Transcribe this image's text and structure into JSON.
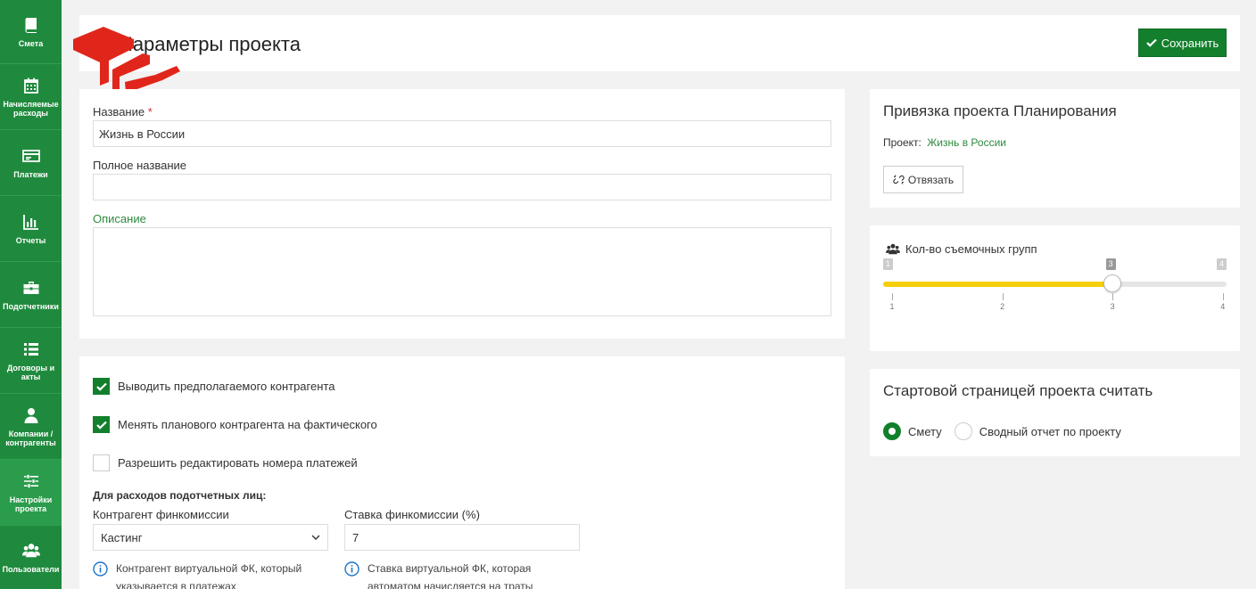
{
  "sidebar": {
    "items": [
      {
        "label": "Смета",
        "icon": "book-icon"
      },
      {
        "label": "Начисляемые расходы",
        "icon": "calendar-icon"
      },
      {
        "label": "Платежи",
        "icon": "card-icon"
      },
      {
        "label": "Отчеты",
        "icon": "bar-chart-icon"
      },
      {
        "label": "Подотчетники",
        "icon": "briefcase-icon"
      },
      {
        "label": "Договоры и акты",
        "icon": "list-icon"
      },
      {
        "label": "Компании / контрагенты",
        "icon": "user-icon"
      },
      {
        "label": "Настройки проекта",
        "icon": "sliders-icon"
      },
      {
        "label": "Пользователи",
        "icon": "users-icon"
      }
    ],
    "active_index": 7
  },
  "header": {
    "title": "Параметры проекта",
    "save_label": "Сохранить"
  },
  "form": {
    "name_label": "Название",
    "name_required_mark": "*",
    "name_value": "Жизнь в России",
    "full_name_label": "Полное название",
    "full_name_value": "",
    "description_label": "Описание",
    "description_value": ""
  },
  "options": {
    "checks": [
      {
        "label": "Выводить предполагаемого контрагента",
        "checked": true
      },
      {
        "label": "Менять планового контрагента на фактического",
        "checked": true
      },
      {
        "label": "Разрешить редактировать номера платежей",
        "checked": false
      }
    ],
    "accountable_title": "Для расходов подотчетных лиц:",
    "counterparty_label": "Контрагент финкомиссии",
    "counterparty_value": "Кастинг",
    "rate_label": "Ставка финкомиссии (%)",
    "rate_value": "7",
    "counterparty_info": "Контрагент виртуальной ФК, который указывается в платежах",
    "rate_info": "Ставка виртуальной ФК, которая автоматом начисляется на траты"
  },
  "binding": {
    "title": "Привязка проекта Планирования",
    "project_label": "Проект:",
    "project_name": "Жизнь в России",
    "unlink_label": "Отвязать"
  },
  "crews": {
    "title": "Кол-во съемочных групп",
    "min": 1,
    "max": 4,
    "value": 3,
    "min_label": "1",
    "max_label": "4",
    "value_label": "3",
    "ticks": [
      "1",
      "2",
      "3",
      "4"
    ],
    "fill_color": "#f5cf0a"
  },
  "start_page": {
    "title": "Стартовой страницей проекта считать",
    "options": [
      {
        "label": "Смету",
        "checked": true
      },
      {
        "label": "Сводный отчет по проекту",
        "checked": false
      }
    ]
  },
  "colors": {
    "sidebar": "#1f8a3d",
    "accent": "#137f2c",
    "link": "#2d8a3d",
    "logo": "#e0261b"
  }
}
